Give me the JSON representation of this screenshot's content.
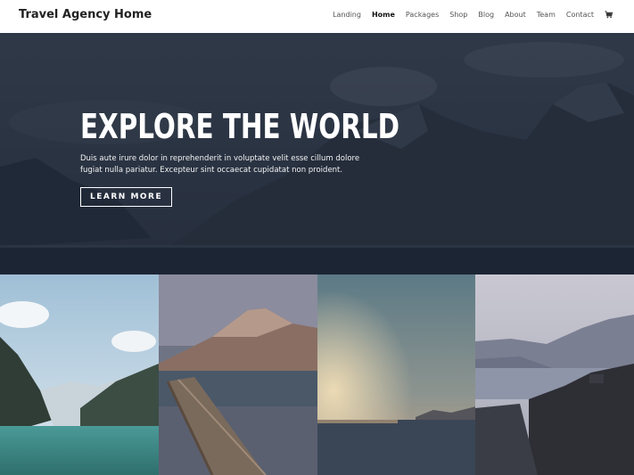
{
  "header": {
    "site_title": "Travel Agency Home",
    "nav": [
      {
        "label": "Landing",
        "active": false
      },
      {
        "label": "Home",
        "active": true
      },
      {
        "label": "Packages",
        "active": false
      },
      {
        "label": "Shop",
        "active": false
      },
      {
        "label": "Blog",
        "active": false
      },
      {
        "label": "About",
        "active": false
      },
      {
        "label": "Team",
        "active": false
      },
      {
        "label": "Contact",
        "active": false
      }
    ],
    "cart_icon": "cart-icon"
  },
  "hero": {
    "title": "EXPLORE THE WORLD",
    "subtitle": "Duis aute irure dolor in reprehenderit in voluptate velit esse cillum dolore fugiat nulla pariatur. Excepteur sint occaecat cupidatat non proident.",
    "button_label": "LEARN MORE",
    "overlay_color": "#1e2738"
  },
  "gallery": {
    "images": [
      "mountain-lake-image",
      "lake-pier-image",
      "sunset-sea-image",
      "river-gorge-image"
    ]
  },
  "colors": {
    "header_bg": "#ffffff",
    "text_dark": "#222222",
    "hero_text": "#ffffff"
  }
}
